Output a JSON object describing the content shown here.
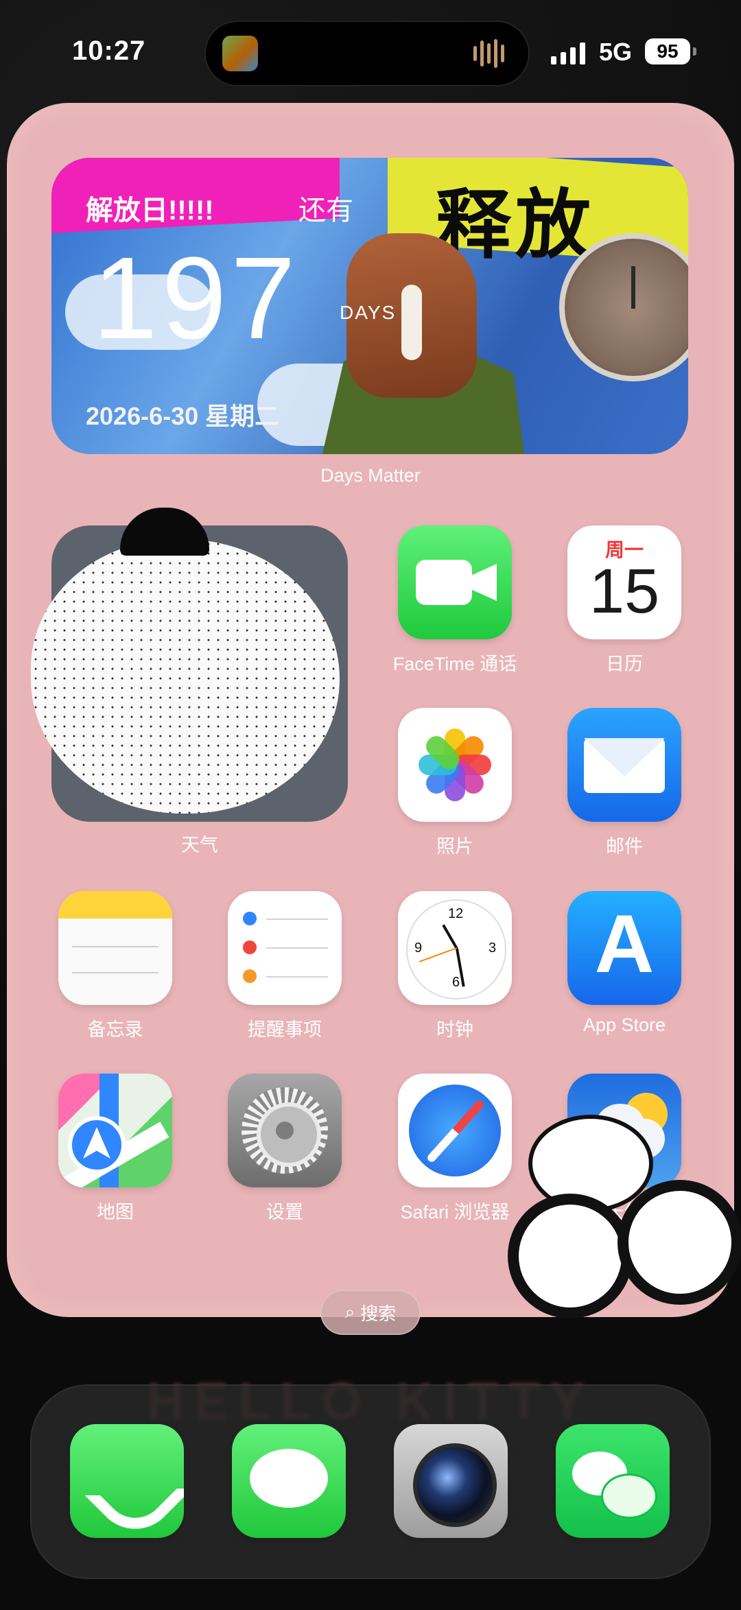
{
  "status_bar": {
    "time": "10:27",
    "network": "5G",
    "battery": "95"
  },
  "days_widget": {
    "title": "解放日!!!!!",
    "still": "还有",
    "count": "197",
    "unit": "DAYS",
    "date": "2026-6-30 星期二",
    "banner": "释放",
    "label": "Days Matter"
  },
  "home": {
    "large_widget_label": "天气",
    "apps": {
      "facetime": "FaceTime 通话",
      "calendar": "日历",
      "calendar_weekday": "周一",
      "calendar_date": "15",
      "photos": "照片",
      "mail": "邮件",
      "notes": "备忘录",
      "reminders": "提醒事项",
      "clock": "时钟",
      "appstore": "App Store",
      "maps": "地图",
      "settings": "设置",
      "safari": "Safari 浏览器",
      "weather": "天气"
    },
    "clock_numbers": [
      "12",
      "3",
      "6",
      "9"
    ]
  },
  "search": {
    "label": "搜索"
  },
  "wallpaper_text": "HELLO KITTY",
  "dock": {
    "apps": [
      "phone",
      "messages",
      "camera",
      "wechat"
    ]
  },
  "colors": {
    "wallpaper": "#e9b4b7",
    "accent_red": "#f0373a"
  }
}
